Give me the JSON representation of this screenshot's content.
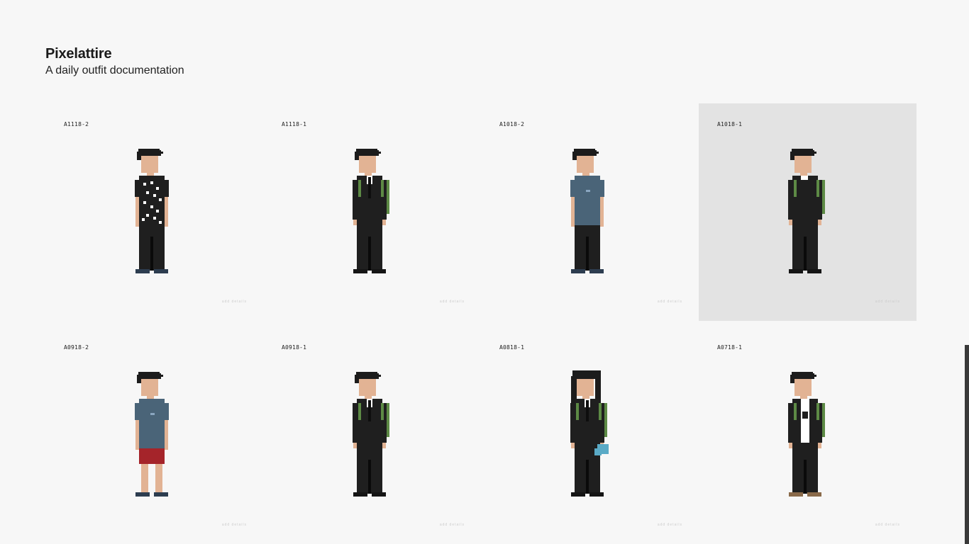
{
  "site": {
    "title": "Pixelattire",
    "subtitle": "A daily outfit documentation"
  },
  "outfits": [
    {
      "id": "A1118-2",
      "footer": "add details",
      "hair": "short",
      "top": "patterned-shirt",
      "bottom": "pants",
      "shoes": "navy",
      "bag": false
    },
    {
      "id": "A1118-1",
      "footer": "add details",
      "hair": "short",
      "top": "black-jacket",
      "bottom": "pants",
      "shoes": "black",
      "bag": true
    },
    {
      "id": "A1018-2",
      "footer": "add details",
      "hair": "short",
      "top": "blue-tee",
      "bottom": "pants",
      "shoes": "navy",
      "bag": false
    },
    {
      "id": "A1018-1",
      "footer": "add details",
      "hair": "short",
      "top": "black-sweater",
      "bottom": "pants",
      "shoes": "black",
      "bag": true,
      "active": true
    },
    {
      "id": "A0918-2",
      "footer": "add details",
      "hair": "short",
      "top": "blue-tee",
      "bottom": "red-shorts",
      "shoes": "navy",
      "bag": false
    },
    {
      "id": "A0918-1",
      "footer": "add details",
      "hair": "short",
      "top": "black-jacket",
      "bottom": "pants",
      "shoes": "black",
      "bag": true
    },
    {
      "id": "A0818-1",
      "footer": "add details",
      "hair": "long",
      "top": "black-jacket",
      "bottom": "pants",
      "shoes": "black",
      "bag": true,
      "cloth": true
    },
    {
      "id": "A0718-1",
      "footer": "add details",
      "hair": "short",
      "top": "jacket-graphic-tee",
      "bottom": "pants",
      "shoes": "brown",
      "bag": true
    }
  ],
  "colors": {
    "skin": "#e2b394",
    "hair": "#1c1c1c",
    "black": "#1f1f1f",
    "blue": "#4a6478",
    "red": "#a5242a",
    "bag": "#5d8a45",
    "navy": "#2d3d50",
    "brown": "#8a6a4a",
    "cloth": "#5aaac6",
    "white": "#ffffff"
  }
}
